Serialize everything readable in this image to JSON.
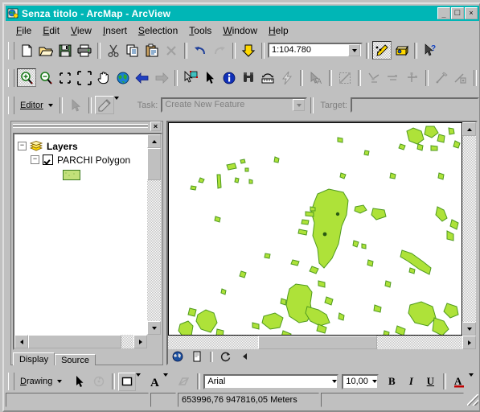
{
  "window": {
    "title": "Senza titolo - ArcMap - ArcView",
    "icon": "arcmap-globe-icon",
    "buttons": {
      "minimize": "_",
      "maximize": "□",
      "close": "×"
    }
  },
  "menubar": {
    "items": [
      {
        "label": "File",
        "accel": "F"
      },
      {
        "label": "Edit",
        "accel": "E"
      },
      {
        "label": "View",
        "accel": "V"
      },
      {
        "label": "Insert",
        "accel": "I"
      },
      {
        "label": "Selection",
        "accel": "S"
      },
      {
        "label": "Tools",
        "accel": "T"
      },
      {
        "label": "Window",
        "accel": "W"
      },
      {
        "label": "Help",
        "accel": "H"
      }
    ]
  },
  "standard_toolbar": {
    "buttons": [
      {
        "name": "new-document-icon",
        "tip": "New"
      },
      {
        "name": "open-folder-icon",
        "tip": "Open"
      },
      {
        "name": "save-icon",
        "tip": "Save"
      },
      {
        "name": "print-icon",
        "tip": "Print"
      },
      {
        "name": "cut-icon",
        "tip": "Cut"
      },
      {
        "name": "copy-icon",
        "tip": "Copy"
      },
      {
        "name": "paste-icon",
        "tip": "Paste"
      },
      {
        "name": "delete-icon",
        "tip": "Delete"
      },
      {
        "name": "undo-icon",
        "tip": "Undo"
      },
      {
        "name": "redo-icon",
        "tip": "Redo"
      },
      {
        "name": "add-data-icon",
        "tip": "Add Data"
      }
    ],
    "scale": {
      "label": "Map Scale",
      "value": "1:104.780"
    },
    "right_buttons": [
      {
        "name": "editor-toolbar-icon",
        "tip": "Editor Toolbar"
      },
      {
        "name": "arctoolbox-icon",
        "tip": "ArcToolbox"
      },
      {
        "name": "help-pointer-icon",
        "tip": "What's This?"
      }
    ]
  },
  "tools_toolbar": {
    "buttons": [
      {
        "name": "zoom-in-icon",
        "tip": "Zoom In",
        "state": "pressed"
      },
      {
        "name": "zoom-out-icon",
        "tip": "Zoom Out",
        "state": "normal"
      },
      {
        "name": "fixed-zoom-in-icon",
        "tip": "Fixed Zoom In",
        "state": "normal"
      },
      {
        "name": "fixed-zoom-out-icon",
        "tip": "Fixed Zoom Out",
        "state": "normal"
      },
      {
        "name": "pan-hand-icon",
        "tip": "Pan",
        "state": "normal"
      },
      {
        "name": "full-extent-globe-icon",
        "tip": "Full Extent",
        "state": "normal"
      },
      {
        "name": "back-extent-icon",
        "tip": "Go Back To Previous Extent",
        "state": "normal"
      },
      {
        "name": "forward-extent-icon",
        "tip": "Go To Next Extent",
        "state": "disabled"
      },
      {
        "name": "select-features-icon",
        "tip": "Select Features",
        "state": "normal"
      },
      {
        "name": "select-elements-icon",
        "tip": "Select Elements",
        "state": "normal"
      },
      {
        "name": "identify-icon",
        "tip": "Identify",
        "state": "normal"
      },
      {
        "name": "find-binoculars-icon",
        "tip": "Find",
        "state": "normal"
      },
      {
        "name": "measure-icon",
        "tip": "Measure",
        "state": "normal"
      },
      {
        "name": "hyperlink-lightning-icon",
        "tip": "Hyperlink",
        "state": "normal"
      },
      {
        "name": "edit-tool-icon",
        "tip": "Edit Tool",
        "state": "disabled"
      },
      {
        "name": "edit-sketch-icon",
        "tip": "Sketch Tool",
        "state": "disabled"
      },
      {
        "name": "split-tool-icon",
        "tip": "Split Tool",
        "state": "disabled"
      },
      {
        "name": "rotate-tool-icon",
        "tip": "Rotate Tool",
        "state": "disabled"
      },
      {
        "name": "attributes-icon",
        "tip": "Attributes",
        "state": "disabled"
      },
      {
        "name": "trace-tool-icon",
        "tip": "Trace",
        "state": "disabled"
      },
      {
        "name": "endpoint-arc-icon",
        "tip": "End Point Arc Tool",
        "state": "disabled"
      },
      {
        "name": "sketch-properties-icon",
        "tip": "Sketch Properties",
        "state": "disabled"
      },
      {
        "name": "help-question-icon",
        "tip": "Help",
        "state": "disabled"
      }
    ]
  },
  "editor_toolbar": {
    "menu_label": "Editor",
    "menu_accel": "r",
    "task_label": "Task:",
    "task_value": "Create New Feature",
    "target_label": "Target:",
    "target_value": "",
    "buttons": [
      {
        "name": "edit-arrow-icon",
        "tip": "Edit Tool"
      },
      {
        "name": "sketch-pencil-icon",
        "tip": "Sketch Tool"
      }
    ]
  },
  "toc": {
    "panel_name": "Table Of Contents",
    "close_label": "×",
    "root": {
      "label": "Layers",
      "expander": "−",
      "icon": "layers-stack-icon"
    },
    "layer": {
      "label": "PARCHI Polygon",
      "expander": "−",
      "checked": true,
      "symbol_fill": "#c2e07a",
      "symbol_outline": "#3a7a20"
    },
    "tabs": [
      {
        "label": "Display",
        "active": true
      },
      {
        "label": "Source",
        "active": false
      }
    ]
  },
  "map_view": {
    "background": "#ffffff",
    "polygon_fill": "#aee239",
    "polygon_outline": "#4f9a1f",
    "bottom_buttons": [
      {
        "name": "data-view-icon",
        "tip": "Data View"
      },
      {
        "name": "layout-view-icon",
        "tip": "Layout View"
      },
      {
        "name": "refresh-view-icon",
        "tip": "Refresh View"
      },
      {
        "name": "pause-drawing-icon",
        "tip": "Pause Drawing"
      }
    ]
  },
  "drawing_toolbar": {
    "menu_label": "Drawing",
    "menu_accel": "D",
    "buttons": [
      {
        "name": "select-arrow-icon",
        "tip": "Select Elements"
      },
      {
        "name": "rotate-element-icon",
        "tip": "Rotate"
      },
      {
        "name": "draw-rectangle-icon",
        "tip": "New Rectangle"
      },
      {
        "name": "text-tool-icon",
        "tip": "New Text"
      },
      {
        "name": "nudge-icon",
        "tip": "Drawing Tools"
      },
      {
        "name": "bold-icon",
        "tip": "Bold",
        "label": "B"
      },
      {
        "name": "italic-icon",
        "tip": "Italic",
        "label": "I"
      },
      {
        "name": "underline-icon",
        "tip": "Underline",
        "label": "U"
      },
      {
        "name": "font-color-icon",
        "tip": "Font Color",
        "label": "A"
      }
    ],
    "font_name": "Arial",
    "font_size": "10,00"
  },
  "statusbar": {
    "left_text": "",
    "coordinates": "653996,76  947816,05 Meters",
    "units": "Meters",
    "right_text": ""
  }
}
